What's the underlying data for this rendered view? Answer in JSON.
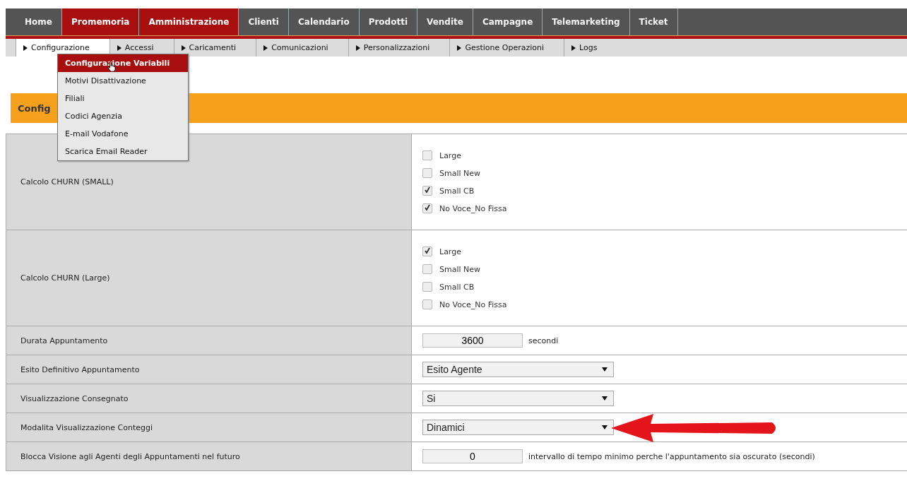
{
  "main_nav": [
    {
      "label": "Home",
      "selected": false
    },
    {
      "label": "Promemoria",
      "selected": true
    },
    {
      "label": "Amministrazione",
      "selected": true
    },
    {
      "label": "Clienti",
      "selected": false
    },
    {
      "label": "Calendario",
      "selected": false
    },
    {
      "label": "Prodotti",
      "selected": false
    },
    {
      "label": "Vendite",
      "selected": false
    },
    {
      "label": "Campagne",
      "selected": false
    },
    {
      "label": "Telemarketing",
      "selected": false
    },
    {
      "label": "Ticket",
      "selected": false
    }
  ],
  "sub_nav": [
    {
      "label": "Configurazione",
      "selected": true
    },
    {
      "label": "Accessi",
      "selected": false
    },
    {
      "label": "Caricamenti",
      "selected": false
    },
    {
      "label": "Comunicazioni",
      "selected": false
    },
    {
      "label": "Personalizzazioni",
      "selected": false
    },
    {
      "label": "Gestione Operazioni",
      "selected": false
    },
    {
      "label": "Logs",
      "selected": false
    }
  ],
  "dropdown_menu": [
    {
      "label": "Configurazione Variabili",
      "selected": true
    },
    {
      "label": "Motivi Disattivazione",
      "selected": false
    },
    {
      "label": "Filiali",
      "selected": false
    },
    {
      "label": "Codici Agenzia",
      "selected": false
    },
    {
      "label": "E-mail Vodafone",
      "selected": false
    },
    {
      "label": "Scarica Email Reader",
      "selected": false
    }
  ],
  "section_title": "Config",
  "settings": [
    {
      "label": "Calcolo CHURN (SMALL)",
      "kind": "checkboxes",
      "options": [
        {
          "label": "Large",
          "checked": false
        },
        {
          "label": "Small New",
          "checked": false
        },
        {
          "label": "Small CB",
          "checked": true
        },
        {
          "label": "No Voce_No Fissa",
          "checked": true
        }
      ]
    },
    {
      "label": "Calcolo CHURN (Large)",
      "kind": "checkboxes",
      "options": [
        {
          "label": "Large",
          "checked": true
        },
        {
          "label": "Small New",
          "checked": false
        },
        {
          "label": "Small CB",
          "checked": false
        },
        {
          "label": "No Voce_No Fissa",
          "checked": false
        }
      ]
    },
    {
      "label": "Durata Appuntamento",
      "kind": "number",
      "value": "3600",
      "unit": "secondi"
    },
    {
      "label": "Esito Definitivo Appuntamento",
      "kind": "select",
      "value": "Esito Agente"
    },
    {
      "label": "Visualizzazione Consegnato",
      "kind": "select",
      "value": "Si"
    },
    {
      "label": "Modalita Visualizzazione Conteggi",
      "kind": "select",
      "value": "Dinamici"
    },
    {
      "label": "Blocca Visione agli Agenti degli Appuntamenti nel futuro",
      "kind": "number",
      "value": "0",
      "unit": "intervallo di tempo minimo perche l'appuntamento sia oscurato (secondi)"
    }
  ]
}
